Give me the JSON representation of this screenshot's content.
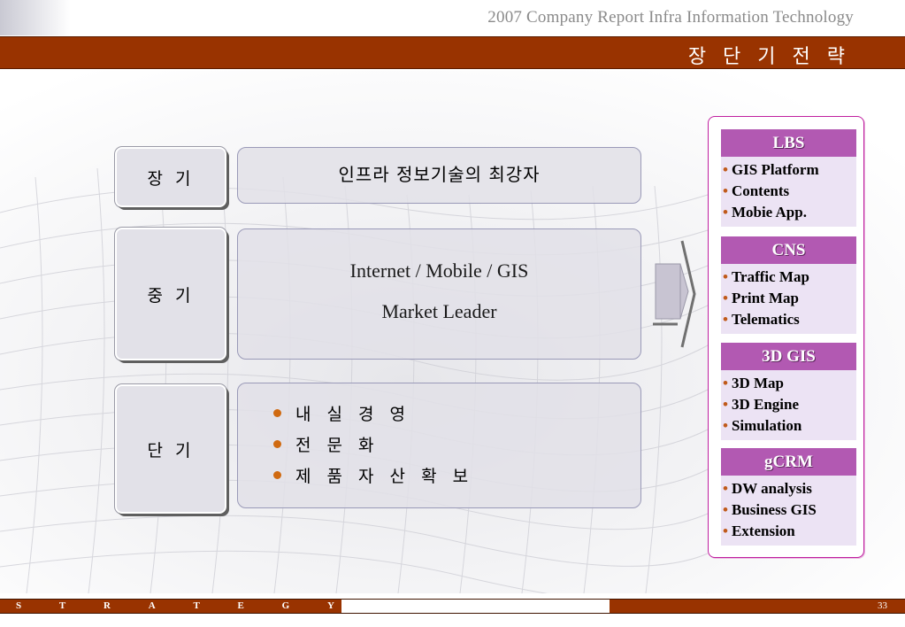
{
  "header": {
    "title": "2007  Company Report   Infra Information Technology",
    "slide_title": "장 단 기 전 략"
  },
  "terms": [
    {
      "label": "장 기",
      "lines": [
        "인프라 정보기술의 최강자"
      ]
    },
    {
      "label": "중 기",
      "lines": [
        "Internet / Mobile / GIS",
        "Market Leader"
      ]
    },
    {
      "label": "단 기",
      "items": [
        "내 실 경 영",
        "전 문 화",
        "제 품 자 산 확 보"
      ]
    }
  ],
  "products": [
    {
      "name": "LBS",
      "items": [
        "GIS Platform",
        "Contents",
        "Mobie App."
      ]
    },
    {
      "name": "CNS",
      "items": [
        "Traffic Map",
        "Print Map",
        "Telematics"
      ]
    },
    {
      "name": "3D GIS",
      "items": [
        "3D Map",
        "3D Engine",
        "Simulation"
      ]
    },
    {
      "name": "gCRM",
      "items": [
        "DW analysis",
        "Business GIS",
        "Extension"
      ]
    }
  ],
  "footer": {
    "letters": [
      "S",
      "T",
      "R",
      "A",
      "T",
      "E",
      "G",
      "Y"
    ],
    "page_number": "33"
  },
  "colors": {
    "brand": "#993300",
    "product_header": "#b259b2",
    "product_body": "#ece3f4",
    "bullet": "#d06a10"
  }
}
